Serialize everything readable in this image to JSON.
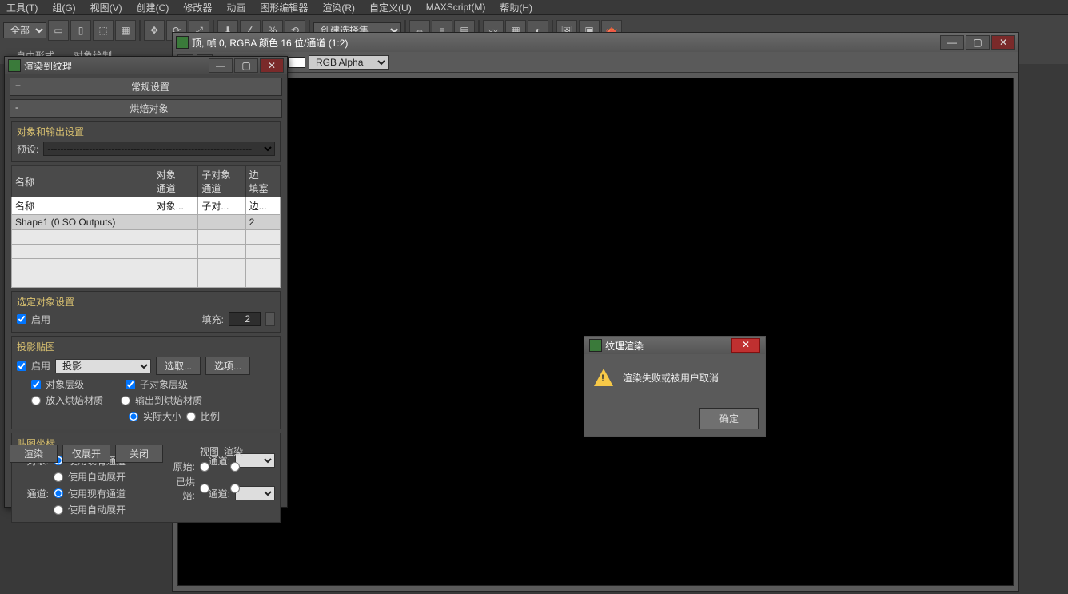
{
  "menu": {
    "tools": "工具(T)",
    "group": "组(G)",
    "view": "视图(V)",
    "create": "创建(C)",
    "modifier": "修改器",
    "anim": "动画",
    "graph": "图形编辑器",
    "render": "渲染(R)",
    "custom": "自定义(U)",
    "maxscript": "MAXScript(M)",
    "help": "帮助(H)"
  },
  "toolbar": {
    "all": "全部",
    "selset": "创建选择集"
  },
  "tabs": {
    "freeform": "自由形式",
    "objpaint": "对象绘制"
  },
  "renderWin": {
    "title": "顶, 帧 0, RGBA 颜色 16 位/通道 (1:2)",
    "channel": "RGB Alpha"
  },
  "rtt": {
    "title": "渲染到纹理",
    "rollout_general": "常规设置",
    "rollout_bake": "烘焙对象",
    "group_objout": "对象和输出设置",
    "preset_lbl": "预设:",
    "table": {
      "h_name": "名称",
      "h_objch": "对象\n通道",
      "h_subch": "子对象\n通道",
      "h_edge": "边\n填塞",
      "h2_name": "名称",
      "h2_obj": "对象...",
      "h2_sub": "子对...",
      "h2_edge": "边...",
      "row_name": "Shape1 (0 SO Outputs)",
      "row_edge": "2"
    },
    "group_sel": "选定对象设置",
    "enable": "启用",
    "padding_lbl": "填充:",
    "padding_val": "2",
    "group_proj": "投影贴图",
    "proj_combo": "投影",
    "pick": "选取...",
    "options": "选项...",
    "obj_level": "对象层级",
    "sub_level": "子对象层级",
    "put_mat": "放入烘焙材质",
    "out_mat": "输出到烘焙材质",
    "actual": "实际大小",
    "ratio": "比例",
    "group_map": "贴图坐标",
    "obj_lbl": "对象:",
    "chan_lbl": "通道:",
    "use_exist": "使用现有通道",
    "use_auto": "使用自动展开",
    "use_exist2": "使用现有通道",
    "use_auto2": "使用自动展开",
    "render": "渲染",
    "unwrap": "仅展开",
    "close": "关闭",
    "orig": "原始:",
    "baked": "已烘焙:",
    "views": "视图",
    "rend": "渲染"
  },
  "msg": {
    "title": "纹理渲染",
    "text": "渲染失败或被用户取消",
    "ok": "确定"
  }
}
